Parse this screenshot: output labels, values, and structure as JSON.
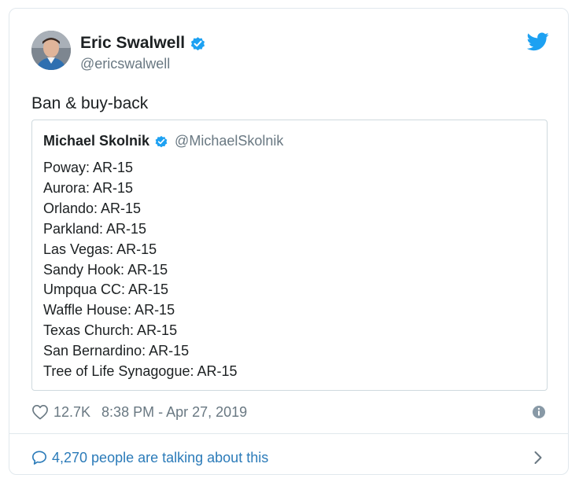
{
  "tweet": {
    "author_name": "Eric Swalwell",
    "author_handle": "@ericswalwell",
    "text": "Ban & buy-back",
    "likes": "12.7K",
    "timestamp": "8:38 PM - Apr 27, 2019",
    "talking": "4,270 people are talking about this"
  },
  "quote": {
    "author_name": "Michael Skolnik",
    "author_handle": "@MichaelSkolnik",
    "lines": [
      "Poway: AR-15",
      "Aurora: AR-15",
      "Orlando: AR-15",
      "Parkland: AR-15",
      "Las Vegas: AR-15",
      "Sandy Hook: AR-15",
      "Umpqua CC: AR-15",
      "Waffle House: AR-15",
      "Texas Church: AR-15",
      "San Bernardino: AR-15",
      "Tree of Life Synagogue: AR-15"
    ]
  },
  "icons": {
    "verified": "verified-badge-icon",
    "brand": "twitter-bird-icon",
    "like": "heart-icon",
    "info": "info-icon",
    "reply": "speech-bubble-icon",
    "chevron": "chevron-right-icon"
  },
  "colors": {
    "brand_blue": "#1da1f2",
    "link_blue": "#2b7bb9",
    "secondary_text": "#697882",
    "border": "#e1e8ed"
  }
}
